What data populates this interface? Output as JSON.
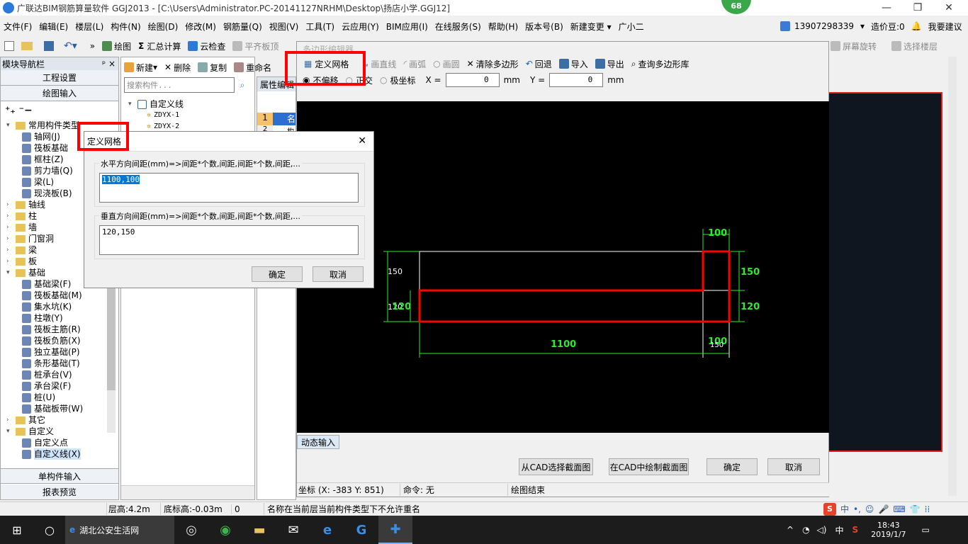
{
  "window": {
    "title": "广联达BIM钢筋算量软件 GGJ2013 - [C:\\Users\\Administrator.PC-20141127NRHM\\Desktop\\扬店小学.GGJ12]",
    "badge": "68",
    "minimize": "—",
    "restore": "❐",
    "close": "✕"
  },
  "menu": [
    "文件(F)",
    "编辑(E)",
    "楼层(L)",
    "构件(N)",
    "绘图(D)",
    "修改(M)",
    "钢筋量(Q)",
    "视图(V)",
    "工具(T)",
    "云应用(Y)",
    "BIM应用(I)",
    "在线服务(S)",
    "帮助(H)",
    "版本号(B)",
    "新建变更 ▾",
    "广小二"
  ],
  "account": {
    "phone": "13907298339",
    "beans": "造价豆:0",
    "suggest": "我要建议"
  },
  "toolbar": {
    "draw": "绘图",
    "sum": "汇总计算",
    "cloud": "云检查",
    "flat": "平齐板顶",
    "rotate": "屏幕旋转",
    "floor": "选择楼层"
  },
  "nav": {
    "title": "模块导航栏",
    "pin": "ᵖ ×",
    "engineering": "工程设置",
    "draw_input": "绘图输入",
    "single_input": "单构件输入",
    "report": "报表预览",
    "tree": [
      {
        "l": 0,
        "e": "▾",
        "t": "f",
        "x": "常用构件类型"
      },
      {
        "l": 1,
        "t": "i",
        "x": "轴网(J)"
      },
      {
        "l": 1,
        "t": "i",
        "x": "筏板基础"
      },
      {
        "l": 1,
        "t": "i",
        "x": "框柱(Z)"
      },
      {
        "l": 1,
        "t": "i",
        "x": "剪力墙(Q)"
      },
      {
        "l": 1,
        "t": "i",
        "x": "梁(L)"
      },
      {
        "l": 1,
        "t": "i",
        "x": "现浇板(B)"
      },
      {
        "l": 0,
        "e": "›",
        "t": "f",
        "x": "轴线"
      },
      {
        "l": 0,
        "e": "›",
        "t": "f",
        "x": "柱"
      },
      {
        "l": 0,
        "e": "›",
        "t": "f",
        "x": "墙"
      },
      {
        "l": 0,
        "e": "›",
        "t": "f",
        "x": "门窗洞"
      },
      {
        "l": 0,
        "e": "›",
        "t": "f",
        "x": "梁"
      },
      {
        "l": 0,
        "e": "›",
        "t": "f",
        "x": "板"
      },
      {
        "l": 0,
        "e": "▾",
        "t": "f",
        "x": "基础"
      },
      {
        "l": 1,
        "t": "i",
        "x": "基础梁(F)"
      },
      {
        "l": 1,
        "t": "i",
        "x": "筏板基础(M)"
      },
      {
        "l": 1,
        "t": "i",
        "x": "集水坑(K)"
      },
      {
        "l": 1,
        "t": "i",
        "x": "柱墩(Y)"
      },
      {
        "l": 1,
        "t": "i",
        "x": "筏板主筋(R)"
      },
      {
        "l": 1,
        "t": "i",
        "x": "筏板负筋(X)"
      },
      {
        "l": 1,
        "t": "i",
        "x": "独立基础(P)"
      },
      {
        "l": 1,
        "t": "i",
        "x": "条形基础(T)"
      },
      {
        "l": 1,
        "t": "i",
        "x": "桩承台(V)"
      },
      {
        "l": 1,
        "t": "i",
        "x": "承台梁(F)"
      },
      {
        "l": 1,
        "t": "i",
        "x": "桩(U)"
      },
      {
        "l": 1,
        "t": "i",
        "x": "基础板带(W)"
      },
      {
        "l": 0,
        "e": "›",
        "t": "f",
        "x": "其它"
      },
      {
        "l": 0,
        "e": "▾",
        "t": "f",
        "x": "自定义"
      },
      {
        "l": 1,
        "t": "i",
        "x": "自定义点"
      },
      {
        "l": 1,
        "t": "i",
        "x": "自定义线(X)"
      }
    ]
  },
  "mid": {
    "new": "新建",
    "delete": "删除",
    "copy": "复制",
    "rename": "重命名",
    "search_placeholder": "搜索构件...",
    "root": "自定义线",
    "items": [
      "ZDYX-1",
      "ZDYX-2"
    ],
    "props": "属性编辑",
    "row1": "1",
    "row1_val": "名",
    "row2": "2",
    "row2_val": "构"
  },
  "editor": {
    "title": "多边形编辑器",
    "define_grid": "定义网格",
    "line": "画直线",
    "arc": "画弧",
    "circle": "画圆",
    "clear": "清除多边形",
    "undo": "回退",
    "import": "导入",
    "export": "导出",
    "query": "查询多边形库",
    "opt_none": "不偏移",
    "opt_ortho": "正交",
    "opt_polar": "极坐标",
    "x_label": "X =",
    "x_val": "0",
    "y_label": "Y =",
    "y_val": "0",
    "unit": "mm",
    "dynamic": "动态输入",
    "from_cad": "从CAD选择截面图",
    "in_cad": "在CAD中绘制截面图",
    "ok": "确定",
    "cancel": "取消",
    "coord": "坐标 (X: -383 Y: 851)",
    "cmd": "命令: 无",
    "status": "绘图结束"
  },
  "cad": {
    "dim_top": "100",
    "dim_right_top": "150",
    "dim_right_bottom": "120",
    "dim_bottom": "1100",
    "dim_bottom_right": "100",
    "dim_bottom_right2": "150",
    "dim_left_top": "150",
    "dim_left_bottom": "120",
    "dim_left_bottom2": "120"
  },
  "dialog": {
    "title": "定义网格",
    "h_label": "水平方向间距(mm)=>间距*个数,间距,间距*个数,间距,...",
    "h_value": "1100,100",
    "v_label": "垂直方向间距(mm)=>间距*个数,间距,间距*个数,间距,...",
    "v_value": "120,150",
    "ok": "确定",
    "cancel": "取消",
    "close": "✕"
  },
  "status": {
    "floor_h": "层高:4.2m",
    "base_h": "底标高:-0.03m",
    "zero": "0",
    "msg": "名称在当前层当前构件类型下不允许重名"
  },
  "taskbar": {
    "search": "湖北公安生活网",
    "time": "18:43",
    "date": "2019/1/7",
    "ime": "中"
  }
}
